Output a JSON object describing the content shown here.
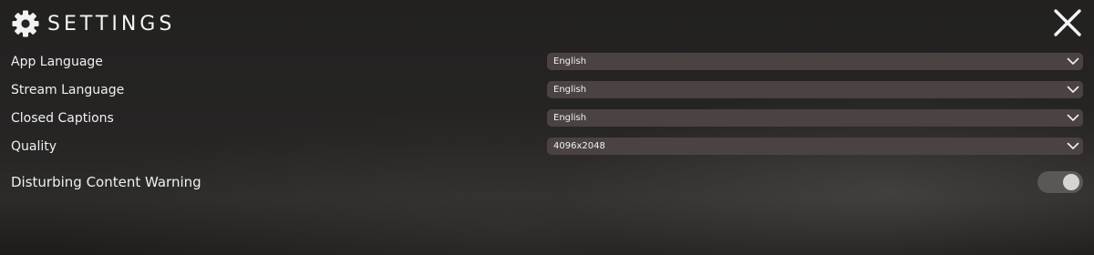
{
  "header": {
    "title": "SETTINGS",
    "settings_icon": "gear-icon",
    "close_icon": "close-icon"
  },
  "settings": {
    "app_language": {
      "label": "App Language",
      "value": "English"
    },
    "stream_language": {
      "label": "Stream Language",
      "value": "English"
    },
    "closed_captions": {
      "label": "Closed Captions",
      "value": "English"
    },
    "quality": {
      "label": "Quality",
      "value": "4096x2048"
    },
    "disturbing_content_warning": {
      "label": "Disturbing Content Warning",
      "enabled": true
    }
  },
  "colors": {
    "background": "#242322",
    "select_background": "#4a4342",
    "toggle_track": "#5b5756",
    "toggle_knob": "#d7d5d4",
    "text": "#f2f2f2"
  }
}
